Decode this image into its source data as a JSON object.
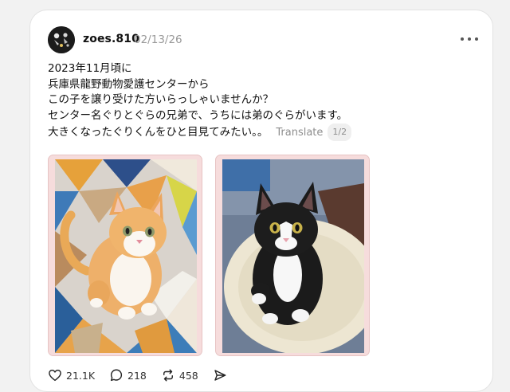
{
  "post": {
    "username": "zoes.810",
    "date": "02/13/26",
    "text_lines": [
      "2023年11月頃に",
      "兵庫県龍野動物愛護センターから",
      "この子を譲り受けた方いらっしゃいませんか？",
      "センター名ぐりとぐらの兄弟で、うちには弟のぐらがいます。",
      "大きくなったぐりくんをひと目見てみたい。。"
    ],
    "translate_label": "Translate",
    "pager_label": "1/2",
    "images": [
      {
        "subject": "orange-white-kitten-photo"
      },
      {
        "subject": "black-white-kitten-photo"
      }
    ]
  },
  "actions": {
    "like_count": "21.1K",
    "reply_count": "218",
    "repost_count": "458"
  },
  "icons": [
    "avatar-icon",
    "more-options-icon",
    "heart-icon",
    "comment-icon",
    "repost-icon",
    "share-icon"
  ],
  "colors": {
    "background": "#f2f2f2",
    "card": "#ffffff",
    "muted_text": "#9a9a9a",
    "photo_frame": "#f6dcdc"
  }
}
